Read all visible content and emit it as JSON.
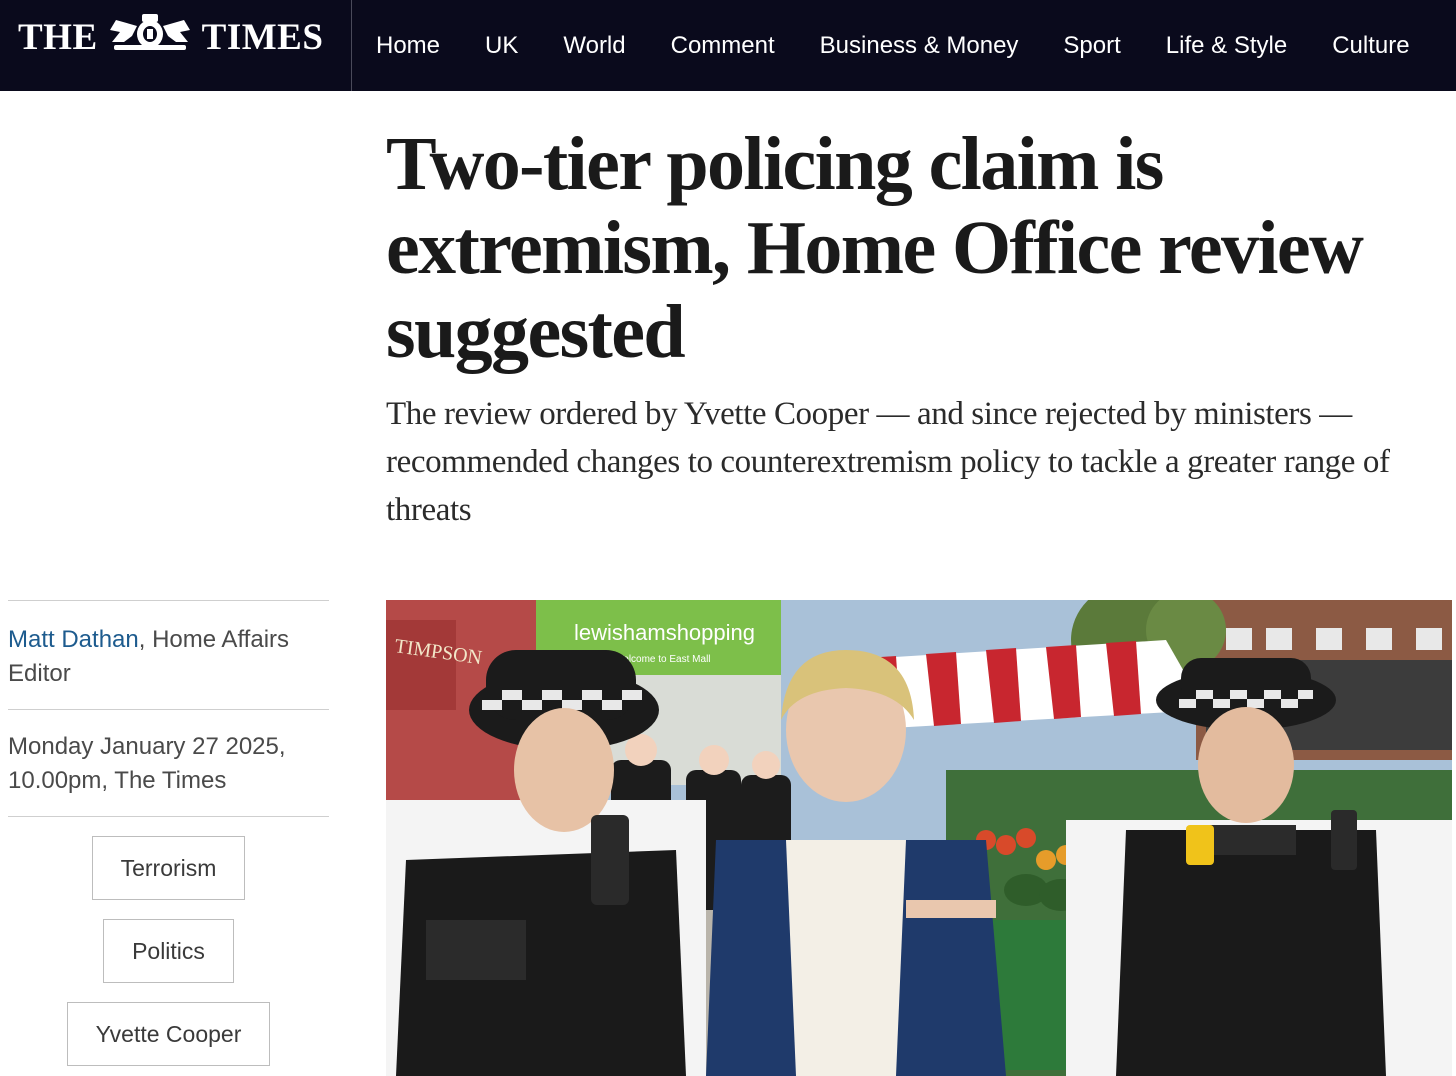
{
  "masthead": {
    "logo_left": "THE",
    "logo_right": "TIMES"
  },
  "nav": {
    "items": [
      "Home",
      "UK",
      "World",
      "Comment",
      "Business & Money",
      "Sport",
      "Life & Style",
      "Culture"
    ]
  },
  "article": {
    "headline": "Two-tier policing claim is extremism, Home Office review suggested",
    "standfirst": "The review ordered by Yvette Cooper — and since rejected by ministers — recommended changes to counterextremism policy to tackle a greater range of threats",
    "author": "Matt Dathan",
    "author_role": ", Home Affairs Editor",
    "date": "Monday January 27 2025, 10.00pm, The Times",
    "tags": [
      "Terrorism",
      "Politics",
      "Yvette Cooper"
    ]
  },
  "photo": {
    "sign_text": "lewishamshopping",
    "sign_subtext": "Welcome to East Mall",
    "shop_sign": "TIMPSON"
  },
  "colors": {
    "masthead_bg": "#0a0a1c",
    "author_link": "#1d5b8e"
  },
  "icons": {
    "crest": "royal-crest-icon"
  }
}
